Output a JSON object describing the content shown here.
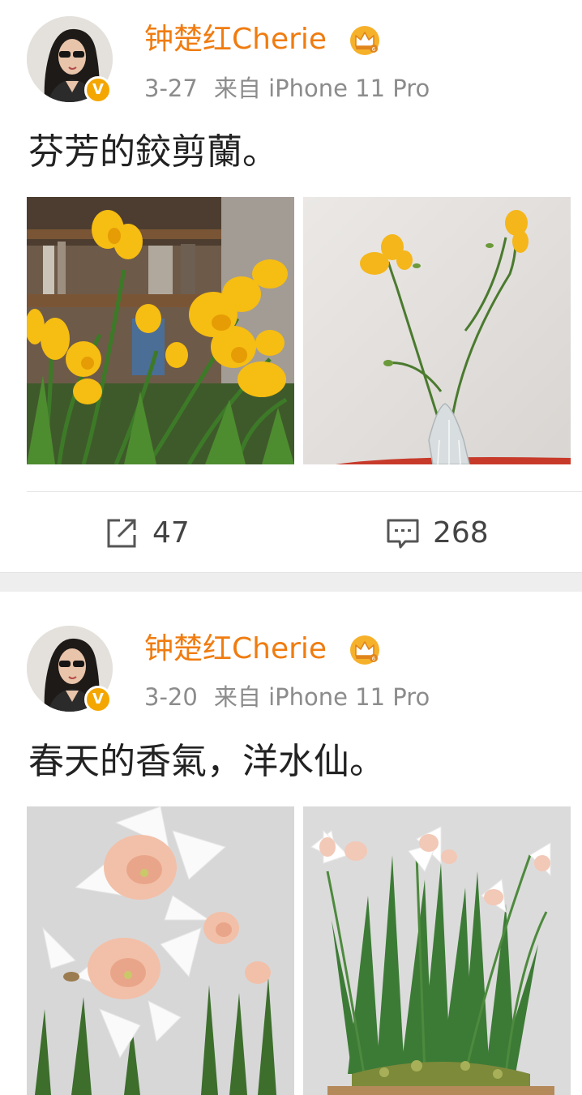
{
  "posts": [
    {
      "username": "钟楚红Cherie",
      "date": "3-27",
      "source_prefix": "来自",
      "source_device": "iPhone 11 Pro",
      "text": "芬芳的鉸剪蘭。",
      "verified_badge": "V",
      "repost_count": "47",
      "comment_count": "268",
      "photos": [
        "yellow-freesia-bouquet",
        "yellow-freesia-in-glass-vase"
      ]
    },
    {
      "username": "钟楚红Cherie",
      "date": "3-20",
      "source_prefix": "来自",
      "source_device": "iPhone 11 Pro",
      "text": "春天的香氣，洋水仙。",
      "verified_badge": "V",
      "photos": [
        "pink-daffodils-closeup",
        "white-daffodils-in-pot"
      ]
    }
  ],
  "colors": {
    "username": "#f07c10",
    "badge": "#f4a700",
    "meta": "#8c8c8c",
    "text": "#222222",
    "separator": "#eeeeee"
  },
  "icons": {
    "repost": "share-square-arrow-icon",
    "comment": "comment-bubble-icon",
    "crown": "vip-crown-icon"
  }
}
